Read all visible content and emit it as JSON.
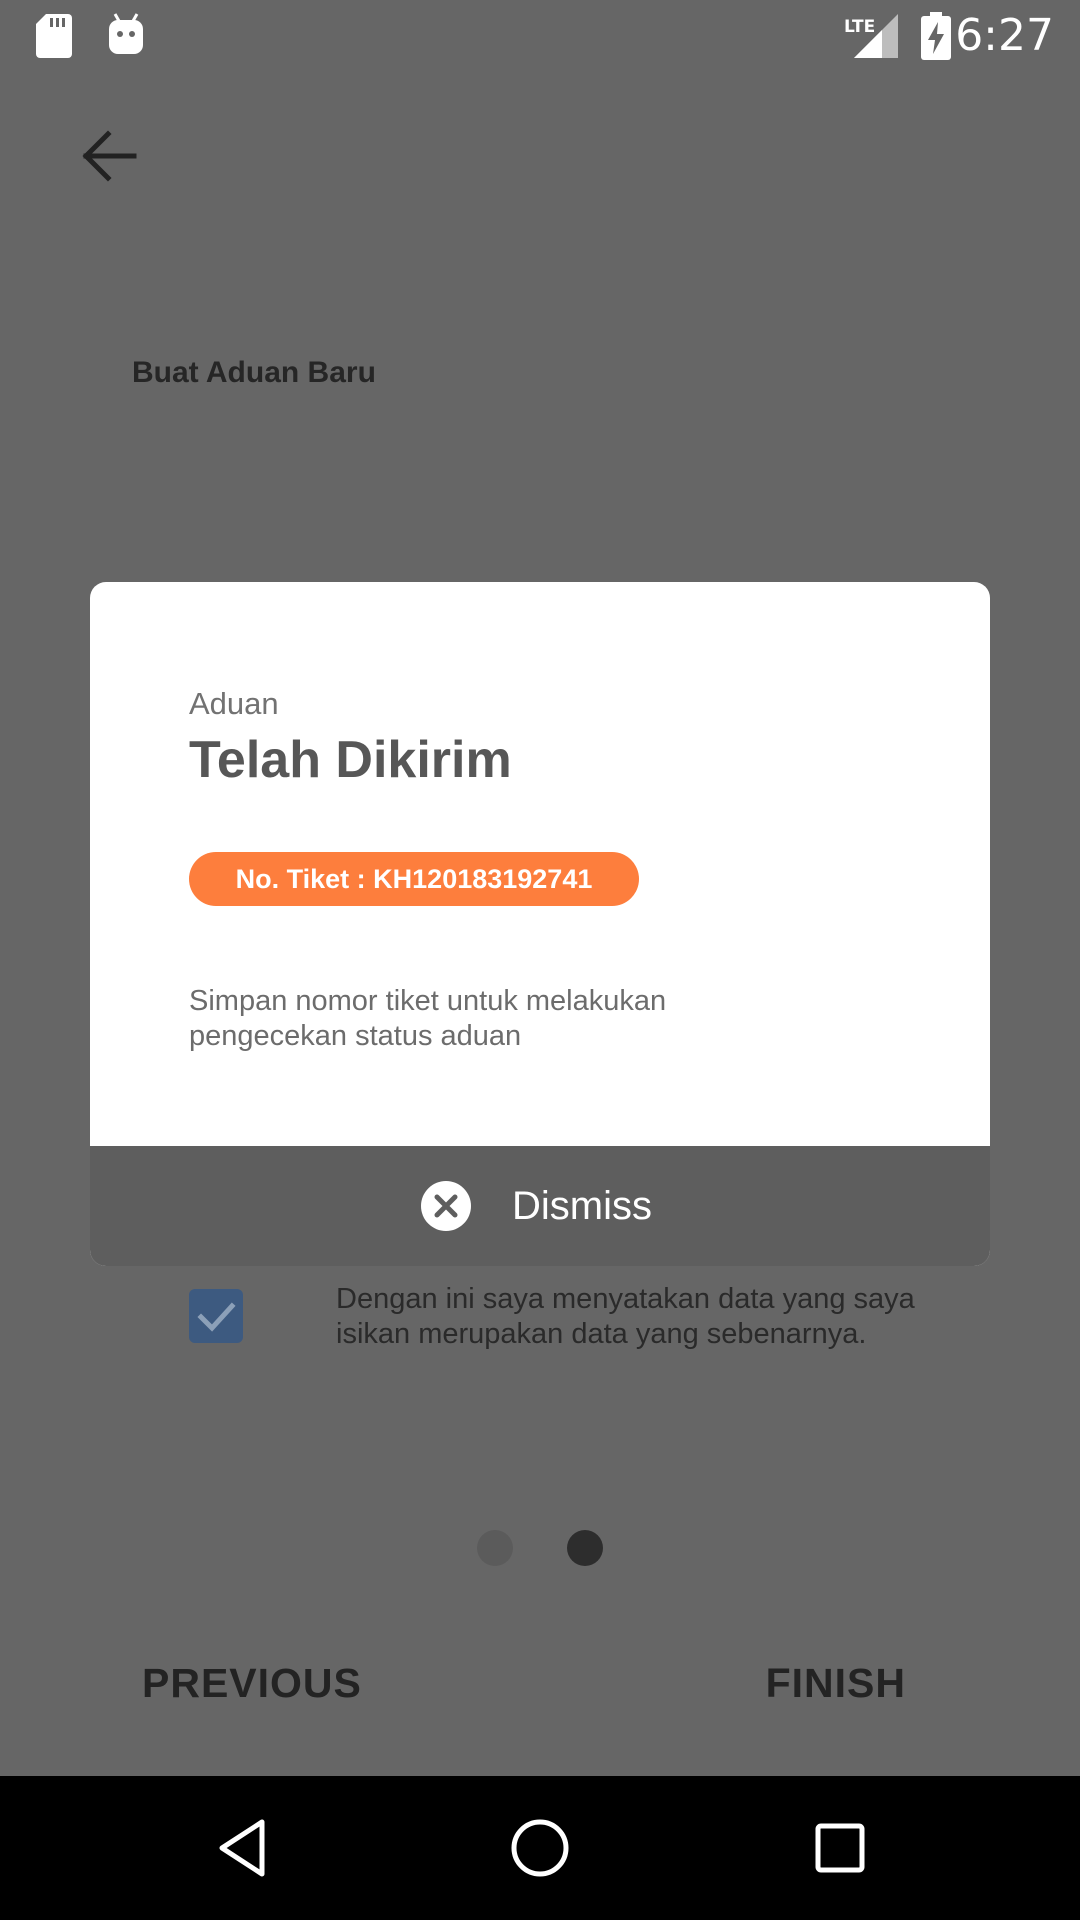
{
  "status_bar": {
    "time": "6:27",
    "network": "LTE",
    "icons": [
      "sd-card-icon",
      "android-icon",
      "lte-signal-icon",
      "battery-charging-icon"
    ]
  },
  "page": {
    "title": "Buat Aduan Baru",
    "agreement_text": "Dengan ini saya menyatakan data yang saya isikan merupakan data yang sebenarnya.",
    "agreement_checked": true,
    "pager": {
      "total": 2,
      "current": 2
    },
    "previous_label": "PREVIOUS",
    "finish_label": "FINISH"
  },
  "dialog": {
    "subtitle": "Aduan",
    "title": "Telah Dikirim",
    "ticket": "No. Tiket : KH120183192741",
    "note": "Simpan nomor tiket untuk melakukan pengecekan status aduan",
    "dismiss_label": "Dismiss"
  },
  "colors": {
    "accent": "#fd7e3d",
    "overlay_background": "#666666",
    "dismiss_bar": "#5e5e5e",
    "checkbox": "#3d5a80"
  }
}
